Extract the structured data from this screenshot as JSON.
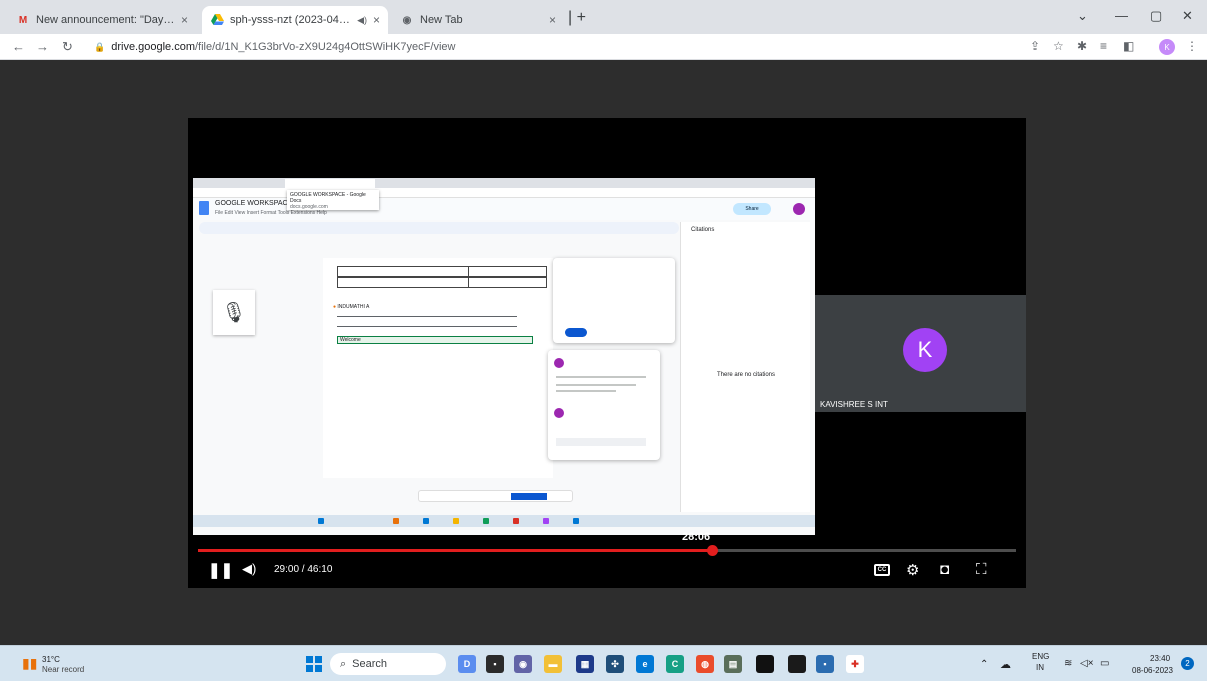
{
  "browser": {
    "tabs": [
      {
        "title": "New announcement: \"Day 5 link",
        "favicon": "gmail-icon",
        "active": false
      },
      {
        "title": "sph-ysss-nzt (2023-04-26 11",
        "favicon": "google-drive-icon",
        "active": true
      },
      {
        "title": "New Tab",
        "favicon": "chrome-icon",
        "active": false
      }
    ],
    "url_host": "drive.google.com",
    "url_path": "/file/d/1N_K1G3brVo-zX9U24g4OttSWiHK7yecF/view",
    "profile_initial": "K"
  },
  "video": {
    "participant_initial": "K",
    "participant_name": "KAVISHREE S INT",
    "inner_screen": {
      "doc_title": "GOOGLE WORKSPACE",
      "tooltip_title": "GOOGLE WORKSPACE - Google Docs",
      "tooltip_host": "docs.google.com",
      "menu": "File  Edit  View  Insert  Format  Tools  Extensions  Help",
      "share_label": "Share",
      "doc_name": "INDUMATHI A",
      "welcome_text": "Welcome",
      "citations_title": "Citations",
      "citations_empty": "There are no citations"
    },
    "hover_time": "28:06",
    "current_time": "29:00",
    "duration": "46:10",
    "progress_fraction": 0.628,
    "cc_label": "CC"
  },
  "taskbar": {
    "weather_temp": "31°C",
    "weather_desc": "Near record",
    "search_label": "Search",
    "lang_top": "ENG",
    "lang_bottom": "IN",
    "time": "23:40",
    "date": "08-06-2023",
    "notif_count": "2"
  },
  "colors": {
    "progress": "#e21e1e",
    "avatar": "#a142f4",
    "start": "#0078d4"
  }
}
